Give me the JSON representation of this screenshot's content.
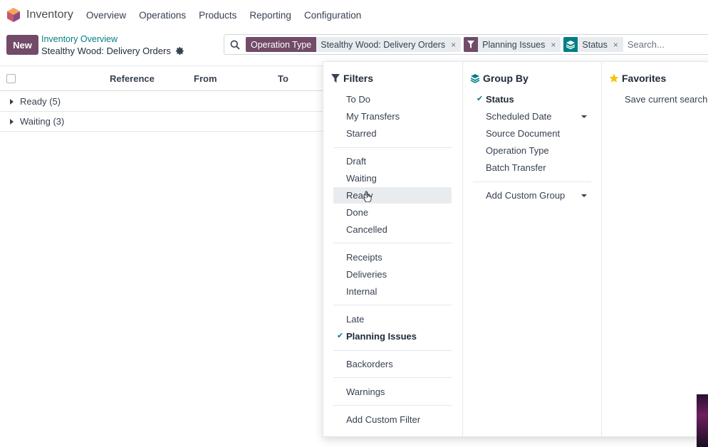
{
  "navbar": {
    "app_name": "Inventory",
    "items": [
      "Overview",
      "Operations",
      "Products",
      "Reporting",
      "Configuration"
    ]
  },
  "control_panel": {
    "new_label": "New",
    "breadcrumb_parent": "Inventory Overview",
    "breadcrumb_current": "Stealthy Wood: Delivery Orders"
  },
  "search": {
    "facets": [
      {
        "label": "Operation Type",
        "value": "Stealthy Wood: Delivery Orders"
      },
      {
        "value": "Planning Issues",
        "icon": "filter-icon"
      },
      {
        "value": "Status",
        "icon": "layers-icon"
      }
    ],
    "close_glyph": "×",
    "placeholder": "Search..."
  },
  "list": {
    "columns": [
      "Reference",
      "From",
      "To"
    ],
    "groups": [
      "Ready (5)",
      "Waiting (3)"
    ]
  },
  "filters": {
    "title": "Filters",
    "sections": [
      [
        "To Do",
        "My Transfers",
        "Starred"
      ],
      [
        "Draft",
        "Waiting",
        "Ready",
        "Done",
        "Cancelled"
      ],
      [
        "Receipts",
        "Deliveries",
        "Internal"
      ],
      [
        "Late",
        "Planning Issues"
      ],
      [
        "Backorders"
      ],
      [
        "Warnings"
      ],
      [
        "Add Custom Filter"
      ]
    ],
    "checked": [
      "Planning Issues"
    ],
    "hovered": "Ready"
  },
  "group_by": {
    "title": "Group By",
    "options": [
      "Status",
      "Scheduled Date",
      "Source Document",
      "Operation Type",
      "Batch Transfer"
    ],
    "checked": [
      "Status"
    ],
    "custom": "Add Custom Group"
  },
  "favorites": {
    "title": "Favorites",
    "save_label": "Save current search"
  },
  "colors": {
    "brand": "#714b67",
    "teal": "#017e84",
    "link": "#017e84"
  }
}
